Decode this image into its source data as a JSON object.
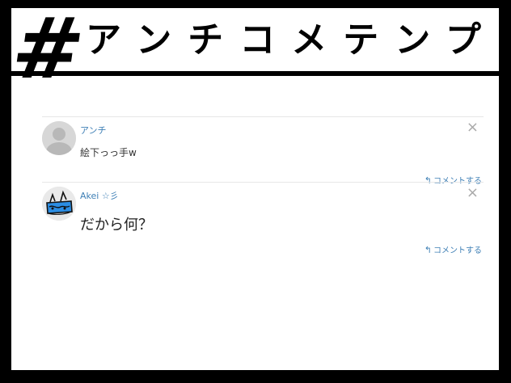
{
  "header": {
    "hash": "#",
    "title": "アンチコメテンプレ"
  },
  "comments": [
    {
      "author": "アンチ",
      "text": "絵下っっ手w",
      "avatar": "default-user-avatar",
      "close_icon": "×",
      "reply_label": "コメントする",
      "reply_icon": "↰"
    },
    {
      "author": "Akei ☆彡",
      "text": "だから何？",
      "avatar": "drawn-character-avatar",
      "close_icon": "×",
      "reply_label": "コメントする",
      "reply_icon": "↰"
    }
  ],
  "colors": {
    "link": "#3e7fb5",
    "frame": "#000000",
    "avatar_bg": "#d7d7d7"
  }
}
